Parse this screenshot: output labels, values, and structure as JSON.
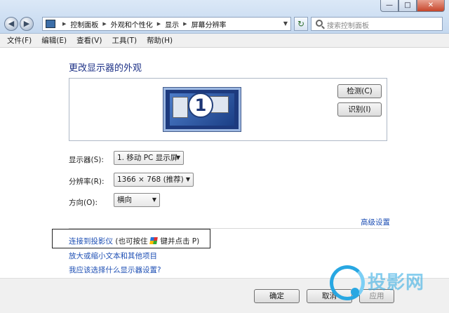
{
  "window": {
    "min_glyph": "—",
    "max_glyph": "□",
    "close_glyph": "✕"
  },
  "address": {
    "crumbs": [
      "控制面板",
      "外观和个性化",
      "显示",
      "屏幕分辨率"
    ]
  },
  "search": {
    "placeholder": "搜索控制面板"
  },
  "menu": [
    "文件(F)",
    "编辑(E)",
    "查看(V)",
    "工具(T)",
    "帮助(H)"
  ],
  "main": {
    "title": "更改显示器的外观",
    "monitor_number": "1",
    "detect_label": "检测(C)",
    "identify_label": "识别(I)",
    "display_label": "显示器(S):",
    "display_value": "1. 移动 PC 显示屏",
    "resolution_label": "分辨率(R):",
    "resolution_value": "1366 × 768 (推荐)",
    "orientation_label": "方向(O):",
    "orientation_value": "横向",
    "advanced_link": "高级设置",
    "projector_link": "连接到投影仪",
    "projector_hint_before": "(也可按住",
    "projector_hint_after": "键并点击 P)",
    "text_size_link": "放大或缩小文本和其他项目",
    "which_settings_link": "我应该选择什么显示器设置?"
  },
  "footer": {
    "ok_label": "确定",
    "cancel_label": "取消",
    "apply_label": "应用"
  },
  "watermark": {
    "text": "投影网"
  },
  "colors": {
    "link": "#1e4fb4",
    "heading": "#1e3287",
    "watermark": "#28a7e2"
  },
  "icons": [
    "back-icon",
    "forward-icon",
    "control-panel-icon",
    "refresh-icon",
    "search-icon",
    "windows-key-icon",
    "monitor-icon"
  ]
}
